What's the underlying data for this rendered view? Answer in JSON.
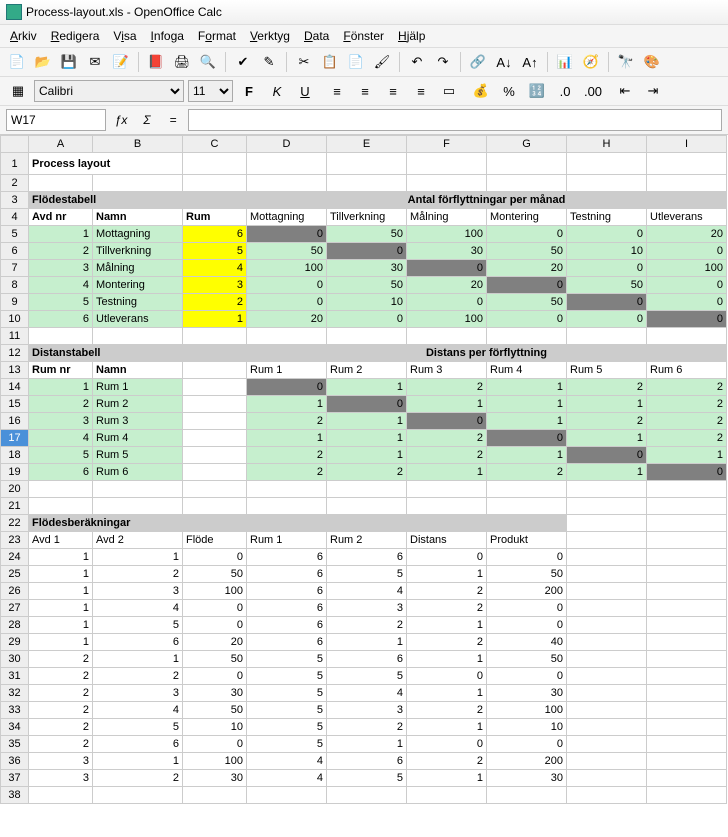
{
  "window": {
    "title": "Process-layout.xls - OpenOffice Calc"
  },
  "menus": [
    "Arkiv",
    "Redigera",
    "Visa",
    "Infoga",
    "Format",
    "Verktyg",
    "Data",
    "Fönster",
    "Hjälp"
  ],
  "font": {
    "name": "Calibri",
    "size": "11"
  },
  "cellRef": "W17",
  "formula": "",
  "cols": [
    "A",
    "B",
    "C",
    "D",
    "E",
    "F",
    "G",
    "H",
    "I"
  ],
  "sheet": {
    "title": "Process layout",
    "flod_header": "Flödestabell",
    "antal_header": "Antal förflyttningar per månad",
    "flod_cols": [
      "Avd nr",
      "Namn",
      "Rum",
      "Mottagning",
      "Tillverkning",
      "Målning",
      "Montering",
      "Testning",
      "Utleverans"
    ],
    "flod_rows": [
      {
        "nr": "1",
        "namn": "Mottagning",
        "rum": "6",
        "v": [
          "0",
          "50",
          "100",
          "0",
          "0",
          "20"
        ]
      },
      {
        "nr": "2",
        "namn": "Tillverkning",
        "rum": "5",
        "v": [
          "50",
          "0",
          "30",
          "50",
          "10",
          "0"
        ]
      },
      {
        "nr": "3",
        "namn": "Målning",
        "rum": "4",
        "v": [
          "100",
          "30",
          "0",
          "20",
          "0",
          "100"
        ]
      },
      {
        "nr": "4",
        "namn": "Montering",
        "rum": "3",
        "v": [
          "0",
          "50",
          "20",
          "0",
          "50",
          "0"
        ]
      },
      {
        "nr": "5",
        "namn": "Testning",
        "rum": "2",
        "v": [
          "0",
          "10",
          "0",
          "50",
          "0",
          "0"
        ]
      },
      {
        "nr": "6",
        "namn": "Utleverans",
        "rum": "1",
        "v": [
          "20",
          "0",
          "100",
          "0",
          "0",
          "0"
        ]
      }
    ],
    "dist_header": "Distanstabell",
    "dist_per": "Distans per förflyttning",
    "dist_cols": [
      "Rum nr",
      "Namn",
      "",
      "Rum 1",
      "Rum 2",
      "Rum 3",
      "Rum 4",
      "Rum 5",
      "Rum 6"
    ],
    "dist_rows": [
      {
        "nr": "1",
        "namn": "Rum 1",
        "v": [
          "0",
          "1",
          "2",
          "1",
          "2",
          "2"
        ]
      },
      {
        "nr": "2",
        "namn": "Rum 2",
        "v": [
          "1",
          "0",
          "1",
          "1",
          "1",
          "2"
        ]
      },
      {
        "nr": "3",
        "namn": "Rum 3",
        "v": [
          "2",
          "1",
          "0",
          "1",
          "2",
          "2"
        ]
      },
      {
        "nr": "4",
        "namn": "Rum 4",
        "v": [
          "1",
          "1",
          "2",
          "0",
          "1",
          "2"
        ]
      },
      {
        "nr": "5",
        "namn": "Rum 5",
        "v": [
          "2",
          "1",
          "2",
          "1",
          "0",
          "1"
        ]
      },
      {
        "nr": "6",
        "namn": "Rum 6",
        "v": [
          "2",
          "2",
          "1",
          "2",
          "1",
          "0"
        ]
      }
    ],
    "calc_header": "Flödesberäkningar",
    "calc_cols": [
      "Avd 1",
      "Avd 2",
      "Flöde",
      "Rum 1",
      "Rum 2",
      "Distans",
      "Produkt"
    ],
    "calc_rows": [
      [
        "1",
        "1",
        "0",
        "6",
        "6",
        "0",
        "0"
      ],
      [
        "1",
        "2",
        "50",
        "6",
        "5",
        "1",
        "50"
      ],
      [
        "1",
        "3",
        "100",
        "6",
        "4",
        "2",
        "200"
      ],
      [
        "1",
        "4",
        "0",
        "6",
        "3",
        "2",
        "0"
      ],
      [
        "1",
        "5",
        "0",
        "6",
        "2",
        "1",
        "0"
      ],
      [
        "1",
        "6",
        "20",
        "6",
        "1",
        "2",
        "40"
      ],
      [
        "2",
        "1",
        "50",
        "5",
        "6",
        "1",
        "50"
      ],
      [
        "2",
        "2",
        "0",
        "5",
        "5",
        "0",
        "0"
      ],
      [
        "2",
        "3",
        "30",
        "5",
        "4",
        "1",
        "30"
      ],
      [
        "2",
        "4",
        "50",
        "5",
        "3",
        "2",
        "100"
      ],
      [
        "2",
        "5",
        "10",
        "5",
        "2",
        "1",
        "10"
      ],
      [
        "2",
        "6",
        "0",
        "5",
        "1",
        "0",
        "0"
      ],
      [
        "3",
        "1",
        "100",
        "4",
        "6",
        "2",
        "200"
      ],
      [
        "3",
        "2",
        "30",
        "4",
        "5",
        "1",
        "30"
      ]
    ]
  }
}
